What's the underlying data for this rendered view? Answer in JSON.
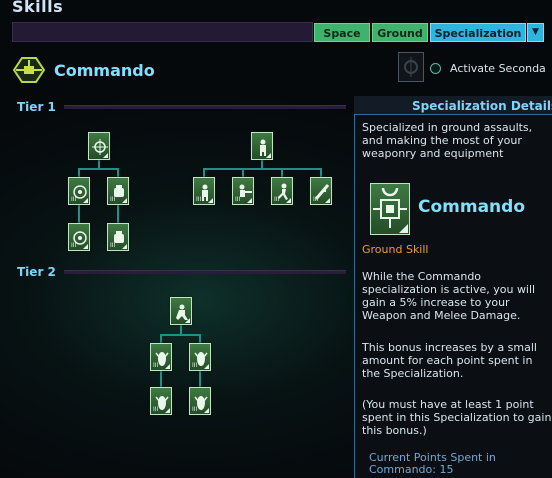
{
  "window": {
    "title": "Skills"
  },
  "tabs": [
    {
      "label": "Space",
      "active": false
    },
    {
      "label": "Ground",
      "active": false
    },
    {
      "label": "Specialization",
      "active": true
    }
  ],
  "spec": {
    "name": "Commando"
  },
  "secondary": {
    "label": "Activate Seconda",
    "checked": false
  },
  "tiers": [
    {
      "label": "Tier 1"
    },
    {
      "label": "Tier 2"
    }
  ],
  "details": {
    "title": "Specialization Details",
    "summary": "Specialized in ground assaults, and making the most of your weaponry and equipment",
    "name": "Commando",
    "type": "Ground Skill",
    "p1": "While the Commando specialization is active, you will gain a 5% increase to your Weapon and Melee Damage.",
    "p2": "This bonus increases by a small amount for each point spent in the Specialization.",
    "p3": "(You must have at least 1 point spent in this Specialization to gain this bonus.)",
    "points": "Current Points Spent in Commando: 15"
  },
  "skill_icons": {
    "t1_root_left": "crosshair-icon",
    "t1_root_right": "soldier-icon",
    "t1_left_a": "scope-icon",
    "t1_left_b": "fist-icon",
    "t1_left_c": "scope-icon",
    "t1_left_d": "fist-icon",
    "t1_right_a": "soldier-icon",
    "t1_right_b": "shooter-icon",
    "t1_right_c": "runner-icon",
    "t1_right_d": "rifle-icon",
    "t2_root": "kneel-icon",
    "t2_a": "claw-icon",
    "t2_b": "claw-icon",
    "t2_c": "claw-icon",
    "t2_d": "claw-icon"
  },
  "colors": {
    "accent": "#7fe0ff",
    "tab_green": "#3fb36d",
    "tab_active": "#2fb3df",
    "skill_green": "#3f7a43",
    "ground_skill": "#e8a030"
  }
}
